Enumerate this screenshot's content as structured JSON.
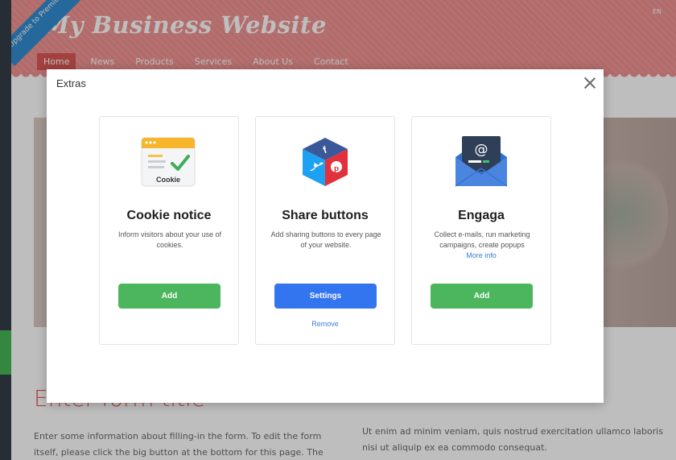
{
  "site": {
    "upgrade_ribbon": "Upgrade to Premium",
    "title": "My Business Website",
    "lang": "EN",
    "nav": [
      "Home",
      "News",
      "Products",
      "Services",
      "About Us",
      "Contact"
    ],
    "form_title": "Enter form title",
    "form_text_left": "Enter some information about filling-in the form. To edit the form itself, please click the big button at the bottom for this page. The filled-in form",
    "form_text_right": "Ut enim ad minim veniam, quis nostrud exercitation ullamco laboris nisi ut aliquip ex ea commodo consequat."
  },
  "modal": {
    "title": "Extras",
    "cards": [
      {
        "title": "Cookie notice",
        "description": "Inform visitors about your use of cookies.",
        "icon_label": "Cookie",
        "button": "Add",
        "icon": "cookie-notice-icon"
      },
      {
        "title": "Share buttons",
        "description": "Add sharing buttons to every page of your website.",
        "button": "Settings",
        "link": "Remove",
        "icon": "share-cube-icon"
      },
      {
        "title": "Engaga",
        "description": "Collect e-mails, run marketing campaigns, create popups",
        "link": "More info",
        "button": "Add",
        "icon": "envelope-at-icon"
      }
    ]
  }
}
